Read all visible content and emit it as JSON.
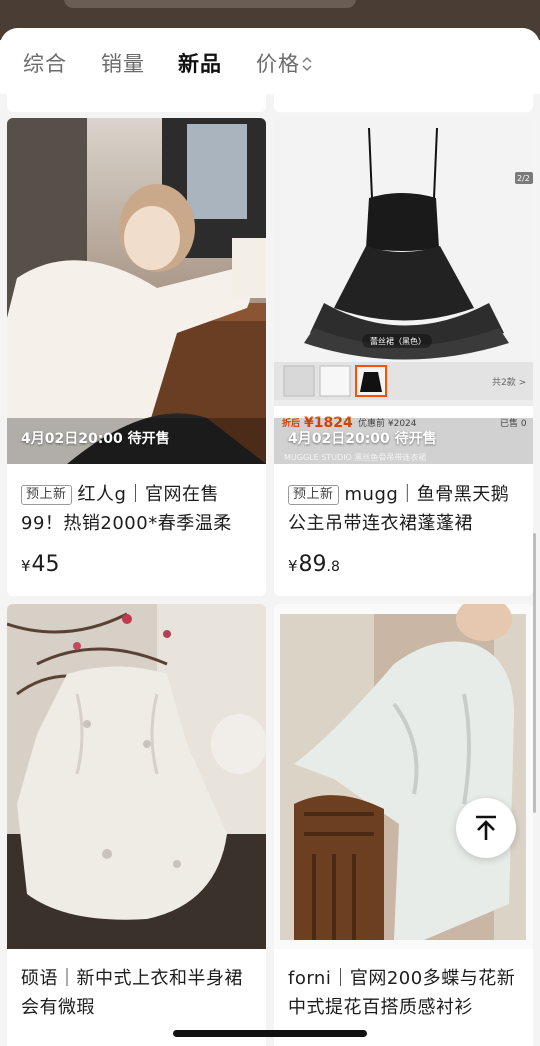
{
  "tabs": [
    {
      "label": "综合"
    },
    {
      "label": "销量"
    },
    {
      "label": "新品",
      "active": true
    },
    {
      "label": "价格"
    }
  ],
  "products": [
    {
      "badge": "预上新",
      "title": "红人g｜官网在售99！热销2000*春季温柔",
      "price_yen": "¥",
      "price_int": "45",
      "price_dec": "",
      "time_label": "4月02日20:00 待开售"
    },
    {
      "badge": "预上新",
      "title": "mugg｜鱼骨黑天鹅公主吊带连衣裙蓬蓬裙",
      "price_yen": "¥",
      "price_int": "89",
      "price_dec": ".8",
      "time_label": "4月02日20:00 待开售",
      "image_overlay": {
        "page_indicator": "2/2",
        "dress_caption": "蕾丝裙（黑色）",
        "count": "共2款 >",
        "promo_label": "折后",
        "promo_price": "¥1824",
        "original_price": "优惠前 ¥2024",
        "sold": "已售 0",
        "cut_text": "MUGGLE STUDIO 黑丝鱼骨吊带连衣裙"
      }
    },
    {
      "badge": "",
      "title": "硕语｜新中式上衣和半身裙 会有微瑕",
      "price_yen": "",
      "price_int": "",
      "price_dec": "",
      "time_label": ""
    },
    {
      "badge": "",
      "title": "forni｜官网200多蝶与花新中式提花百搭质感衬衫",
      "price_yen": "",
      "price_int": "",
      "price_dec": "",
      "time_label": ""
    }
  ],
  "colors": {
    "accent": "#ff5000",
    "text": "#1d1d1d",
    "muted": "#6b6b6b"
  },
  "icons": {
    "sort": "sort-updown-icon",
    "scroll_top": "arrow-up-to-top-icon"
  }
}
